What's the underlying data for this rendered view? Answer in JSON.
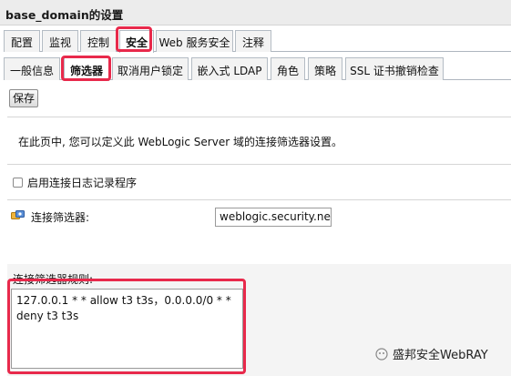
{
  "window_title": "base_domain的设置",
  "main_tabs": [
    {
      "label": "配置"
    },
    {
      "label": "监视"
    },
    {
      "label": "控制"
    },
    {
      "label": "安全"
    },
    {
      "label": "Web 服务安全"
    },
    {
      "label": "注释"
    }
  ],
  "main_tabs_active": "安全",
  "sub_tabs": [
    {
      "label": "一般信息"
    },
    {
      "label": "筛选器"
    },
    {
      "label": "取消用户锁定"
    },
    {
      "label": "嵌入式 LDAP"
    },
    {
      "label": "角色"
    },
    {
      "label": "策略"
    },
    {
      "label": "SSL 证书撤销检查"
    }
  ],
  "sub_tabs_active": "筛选器",
  "toolbar": {
    "save_label": "保存"
  },
  "description": "在此页中, 您可以定义此 WebLogic Server 域的连接筛选器设置。",
  "logging_checkbox": {
    "label": "启用连接日志记录程序",
    "checked": false
  },
  "connection_filter": {
    "label": "连接筛选器:",
    "value": "weblogic.security.net.ConnectionFilterImpl"
  },
  "filter_rules": {
    "label": "连接筛选器规则:",
    "value": "127.0.0.1 * * allow t3 t3s，0.0.0.0/0 * * deny t3 t3s"
  },
  "watermark": {
    "text": "盛邦安全WebRAY"
  },
  "colors": {
    "highlight": "#e8294b",
    "title_bar": "#ececec",
    "tab_bg": "#f3f3f3"
  }
}
